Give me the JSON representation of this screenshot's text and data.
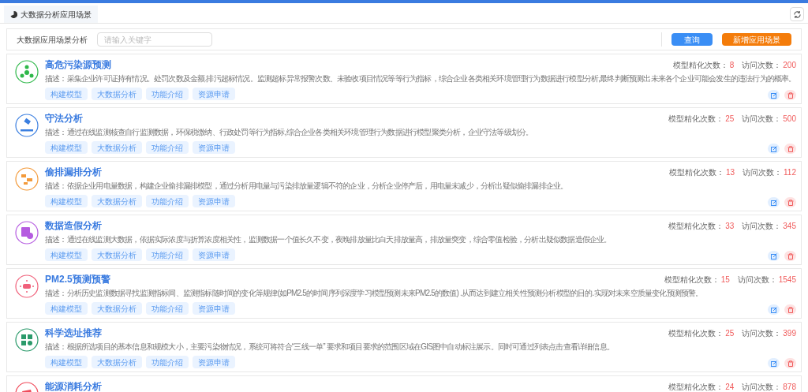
{
  "tabs": [
    {
      "label": "大数据分析应用场景",
      "selected": true
    }
  ],
  "search": {
    "label": "大数据应用场景分析",
    "placeholder": "请输入关键字",
    "buttons": [
      {
        "label": "查询",
        "kind": "primary"
      },
      {
        "label": "新增应用场景",
        "kind": "warning"
      }
    ]
  },
  "cards": [
    {
      "title": "高危污染源预测",
      "color": "#2fb84a",
      "description": "描述：采集企业许可证持有情况。处罚次数及金额.排污超标情况。监测超标异常报警次数、未验收项目情况等等行为指标，综合企业各类相关环境管理行为数据进行模型分析,最终判断预测出未来各个企业可能会发生的违法行为的概率。",
      "tags": [
        "构建模型",
        "大数据分析",
        "功能介绍",
        "资源申请"
      ],
      "stats": [
        {
          "label": "模型精化次数：",
          "value": "8"
        },
        {
          "label": "访问次数：",
          "value": "200"
        }
      ]
    },
    {
      "title": "守法分析",
      "color": "#3b7fe0",
      "description": "描述：通过在线监测核查自行监测数据，环保税缴纳、行政处罚等行为指标,综合企业各类相关环境管理行为数据进行模型聚类分析，企业守法等级划分。",
      "tags": [
        "构建模型",
        "大数据分析",
        "功能介绍",
        "资源申请"
      ],
      "stats": [
        {
          "label": "模型精化次数：",
          "value": "25"
        },
        {
          "label": "访问次数：",
          "value": "500"
        }
      ]
    },
    {
      "title": "偷排漏排分析",
      "color": "#f39a3a",
      "description": "描述：依据企业用电量数据，构建企业偷排漏排模型，通过分析用电量与污染排放量逻辑不符的企业，分析企业停产后，用电量未减少，分析出疑似偷排漏排企业。",
      "tags": [
        "构建模型",
        "大数据分析",
        "功能介绍",
        "资源申请"
      ],
      "stats": [
        {
          "label": "模型精化次数：",
          "value": "13"
        },
        {
          "label": "访问次数：",
          "value": "112"
        }
      ]
    },
    {
      "title": "数据造假分析",
      "color": "#b55be0",
      "description": "描述：通过在线监测大数据，依据实际浓度与折算浓度相关性，监测数据一个值长久不变，夜晚排放量比白天排放量高，排放量突变，综合零值检验，分析出疑似数据造假企业。",
      "tags": [
        "构建模型",
        "大数据分析",
        "功能介绍",
        "资源申请"
      ],
      "stats": [
        {
          "label": "模型精化次数：",
          "value": "33"
        },
        {
          "label": "访问次数：",
          "value": "345"
        }
      ]
    },
    {
      "title": "PM2.5预测预警",
      "color": "#f0607a",
      "description": "描述：分析历史监测数据寻找监测指标间、监测指标随时间的变化等规律(如PM2.5的时间序列深度学习模型预测未来PM2.5的数值) .从而达到建立相关性预测分析模型的目的.实现对未来空质量变化预测预警。",
      "tags": [
        "构建模型",
        "大数据分析",
        "功能介绍",
        "资源申请"
      ],
      "stats": [
        {
          "label": "模型精化次数：",
          "value": "15"
        },
        {
          "label": "访问次数：",
          "value": "1545"
        }
      ]
    },
    {
      "title": "科学选址推荐",
      "color": "#2a9a6a",
      "description": "描述：根据所选项目的基本信息和规模大小，主要污染物情况，系统可将符合“三线一单” 要求和项目要求的范围区域在GIS图中自动标注展示。同时可通过列表点击查看详细信息。",
      "tags": [
        "构建模型",
        "大数据分析",
        "功能介绍",
        "资源申请"
      ],
      "stats": [
        {
          "label": "模型精化次数：",
          "value": "25"
        },
        {
          "label": "访问次数：",
          "value": "399"
        }
      ]
    },
    {
      "title": "能源消耗分析",
      "color": "#f04a5a",
      "stats": [
        {
          "label": "模型精化次数：",
          "value": "24"
        },
        {
          "label": "访问次数：",
          "value": "878"
        }
      ]
    }
  ]
}
